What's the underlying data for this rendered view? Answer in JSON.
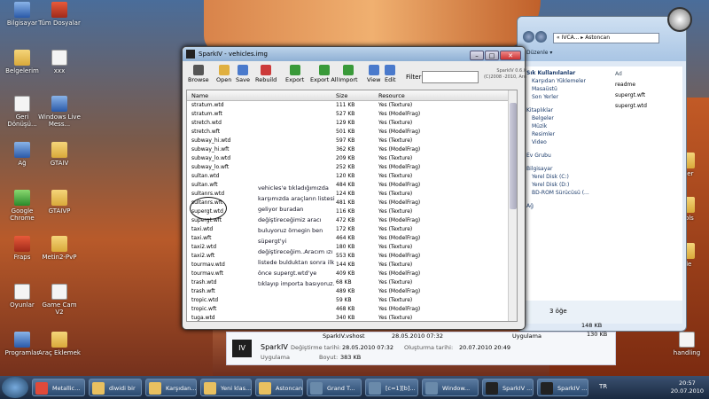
{
  "desktop": {
    "icons": [
      {
        "label": "Bilgisayar",
        "style": "blue"
      },
      {
        "label": "Tüm Dosyalar",
        "style": "red"
      },
      {
        "label": "Belgelerim",
        "style": "folder"
      },
      {
        "label": "xxx",
        "style": "white"
      },
      {
        "label": "Geri Dönüşü...",
        "style": "white"
      },
      {
        "label": "Windows Live Mess...",
        "style": "blue"
      },
      {
        "label": "Ağ",
        "style": "blue"
      },
      {
        "label": "GTAIV",
        "style": "folder"
      },
      {
        "label": "Google Chrome",
        "style": "green"
      },
      {
        "label": "GTAIVP",
        "style": "folder"
      },
      {
        "label": "Fraps",
        "style": "red"
      },
      {
        "label": "Metin2-PvP",
        "style": "folder"
      },
      {
        "label": "Oyunlar",
        "style": "white"
      },
      {
        "label": "Game Cam V2",
        "style": "white"
      },
      {
        "label": "Programlar",
        "style": "blue"
      },
      {
        "label": "Araç Eklemek",
        "style": "folder"
      }
    ],
    "right_icons": [
      "içler",
      "icols",
      "ide",
      "handling"
    ]
  },
  "explorer": {
    "address": "« IVCA... ▸ Astoncan",
    "toolbar_label": "Düzenle ▾",
    "sidebar": {
      "favorites_header": "Sık Kullanılanlar",
      "favorites": [
        "Karşıdan Yüklemeler",
        "Masaüstü",
        "Son Yerler"
      ],
      "libraries_header": "Kitaplıklar",
      "libraries": [
        "Belgeler",
        "Müzik",
        "Resimler",
        "Video"
      ],
      "homegroup": "Ev Grubu",
      "computer_header": "Bilgisayar",
      "drives": [
        "Yerel Disk (C:)",
        "Yerel Disk (D:)",
        "BD-ROM Sürücüsü (..."
      ],
      "network": "Ağ"
    },
    "list_header": "Ad",
    "files": [
      "readme",
      "supergt.wft",
      "supergt.wtd"
    ],
    "status": "3 öğe"
  },
  "sparkiv": {
    "title": "SparkIV - vehicles.img",
    "window_buttons": {
      "minimize": "–",
      "maximize": "□",
      "close": "✕"
    },
    "toolbar": [
      {
        "label": "Browse",
        "color": "#555"
      },
      {
        "label": "Open",
        "color": "#e0b040"
      },
      {
        "label": "Save",
        "color": "#4a7acc"
      },
      {
        "label": "Rebuild",
        "color": "#cc3a3a"
      },
      {
        "label": "Export",
        "color": "#3a9a3a"
      },
      {
        "label": "Export All",
        "color": "#3a9a3a"
      },
      {
        "label": "Import",
        "color": "#3a9a3a"
      },
      {
        "label": "View",
        "color": "#4a7acc"
      },
      {
        "label": "Edit",
        "color": "#4a7acc"
      }
    ],
    "filter_label": "Filter:",
    "version": "SparkIV 0.6.0 (C)2008 -2010, Aru",
    "columns": {
      "name": "Name",
      "size": "Size",
      "resource": "Resource"
    },
    "rows": [
      [
        "stratum.wtd",
        "111 KB",
        "Yes (Texture)"
      ],
      [
        "stratum.wft",
        "527 KB",
        "Yes (ModelFrag)"
      ],
      [
        "stretch.wtd",
        "129 KB",
        "Yes (Texture)"
      ],
      [
        "stretch.wft",
        "501 KB",
        "Yes (ModelFrag)"
      ],
      [
        "subway_hi.wtd",
        "597 KB",
        "Yes (Texture)"
      ],
      [
        "subway_hi.wft",
        "362 KB",
        "Yes (ModelFrag)"
      ],
      [
        "subway_lo.wtd",
        "209 KB",
        "Yes (Texture)"
      ],
      [
        "subway_lo.wft",
        "252 KB",
        "Yes (ModelFrag)"
      ],
      [
        "sultan.wtd",
        "120 KB",
        "Yes (Texture)"
      ],
      [
        "sultan.wft",
        "484 KB",
        "Yes (ModelFrag)"
      ],
      [
        "sultanrs.wtd",
        "124 KB",
        "Yes (Texture)"
      ],
      [
        "sultanrs.wft",
        "481 KB",
        "Yes (ModelFrag)"
      ],
      [
        "supergt.wtd",
        "116 KB",
        "Yes (Texture)"
      ],
      [
        "supergt.wft",
        "472 KB",
        "Yes (ModelFrag)"
      ],
      [
        "taxi.wtd",
        "172 KB",
        "Yes (Texture)"
      ],
      [
        "taxi.wft",
        "464 KB",
        "Yes (ModelFrag)"
      ],
      [
        "taxi2.wtd",
        "180 KB",
        "Yes (Texture)"
      ],
      [
        "taxi2.wft",
        "553 KB",
        "Yes (ModelFrag)"
      ],
      [
        "tourmav.wtd",
        "144 KB",
        "Yes (Texture)"
      ],
      [
        "tourmav.wft",
        "409 KB",
        "Yes (ModelFrag)"
      ],
      [
        "trash.wtd",
        "68 KB",
        "Yes (Texture)"
      ],
      [
        "trash.wft",
        "489 KB",
        "Yes (ModelFrag)"
      ],
      [
        "tropic.wtd",
        "59 KB",
        "Yes (Texture)"
      ],
      [
        "tropic.wft",
        "468 KB",
        "Yes (ModelFrag)"
      ],
      [
        "tuga.wtd",
        "340 KB",
        "Yes (Texture)"
      ]
    ],
    "note": "vehicles'e tıkladığımızda karşımızda araçların listesi geliyor buradan değiştireceğimiz aracı buluyoruz örnegin ben süpergt'yi değiştireceğim..Aracım ızı listede bulduktan sonra ilk önce supergt.wtd'ye tıklayıp importa basıyoruz."
  },
  "infostrip": {
    "icon_text": "IV",
    "top_left": "SparkIV.vshost",
    "top_mid": "28.05.2010 07:32",
    "top_right": "Uygulama",
    "name": "SparkIV",
    "modified_label": "Değiştirme tarihi:",
    "modified": "28.05.2010 07:32",
    "created_label": "Oluşturma tarihi:",
    "created": "20.07.2010 20:49",
    "type": "Uygulama",
    "size_label": "Boyut:",
    "size": "383 KB",
    "size_a": "148 KB",
    "size_b": "130 KB"
  },
  "taskbar": {
    "items": [
      {
        "label": "Metallic...",
        "color": "#e04a3a"
      },
      {
        "label": "diwidi bir",
        "color": "#e8c060"
      },
      {
        "label": "Karşıdan...",
        "color": "#e8c060"
      },
      {
        "label": "Yeni klas...",
        "color": "#e8c060"
      },
      {
        "label": "Astoncan",
        "color": "#e8c060"
      },
      {
        "label": "Grand T...",
        "color": "#6a8aaa"
      },
      {
        "label": "[c=1][b]...",
        "color": "#6a8aaa"
      },
      {
        "label": "Window...",
        "color": "#6a8aaa"
      },
      {
        "label": "SparkIV ...",
        "color": "#222"
      },
      {
        "label": "SparkIV ...",
        "color": "#222"
      }
    ],
    "lang": "TR",
    "time": "20:57",
    "date": "20.07.2010"
  }
}
